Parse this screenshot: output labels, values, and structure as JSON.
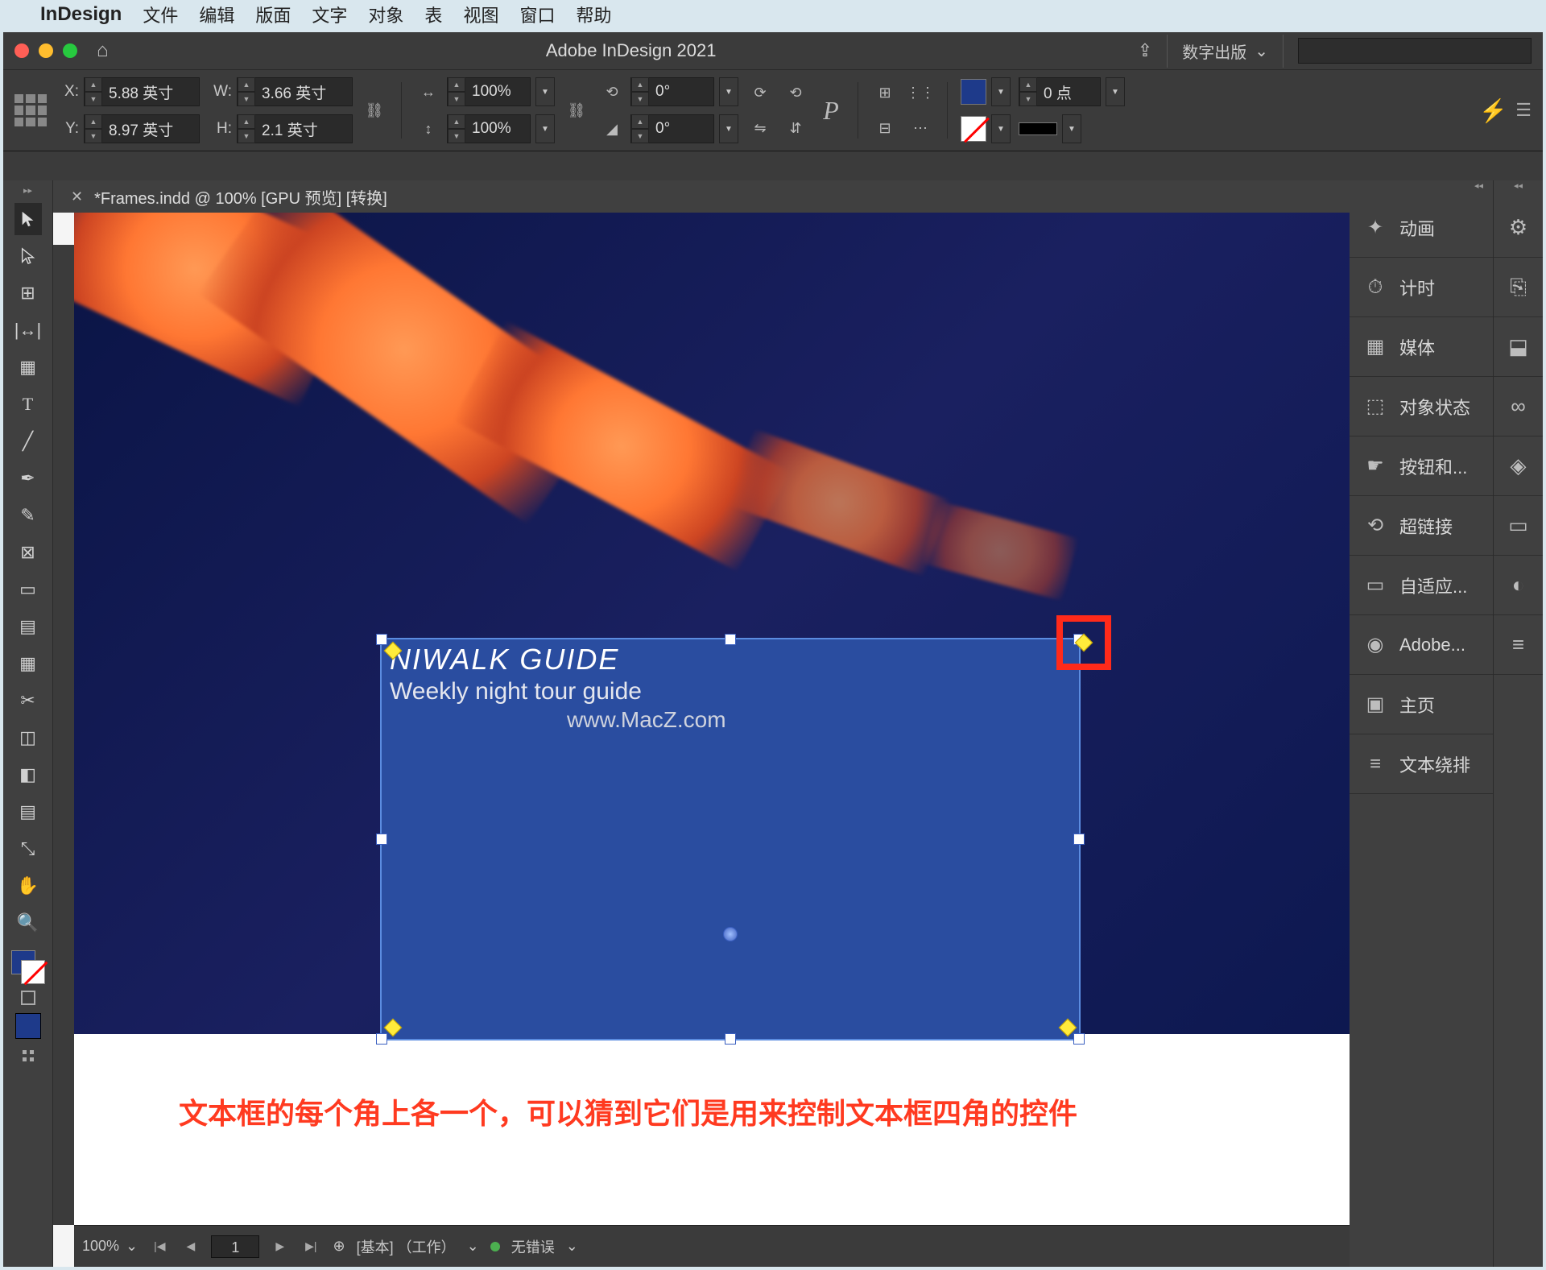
{
  "mac_menu": {
    "app_name": "InDesign",
    "items": [
      "文件",
      "编辑",
      "版面",
      "文字",
      "对象",
      "表",
      "视图",
      "窗口",
      "帮助"
    ]
  },
  "titlebar": {
    "title": "Adobe InDesign 2021",
    "workspace": "数字出版"
  },
  "control": {
    "x": "5.88 英寸",
    "y": "8.97 英寸",
    "w": "3.66 英寸",
    "h": "2.1 英寸",
    "scale_x": "100%",
    "scale_y": "100%",
    "rotate": "0°",
    "shear": "0°",
    "stroke_pt": "0 点",
    "fill_color": "#1e3a8a"
  },
  "doc_tab": "*Frames.indd @ 100% [GPU 预览] [转换]",
  "text_frame": {
    "line1": "NIWALK  GUIDE",
    "line2": "Weekly night tour guide",
    "line3": "www.MacZ.com"
  },
  "annotation": "文本框的每个角上各一个，可以猜到它们是用来控制文本框四角的控件",
  "status": {
    "zoom": "100%",
    "page": "1",
    "preset": "[基本] （工作）",
    "errors": "无错误"
  },
  "panels": [
    {
      "icon": "✦",
      "label": "动画"
    },
    {
      "icon": "⏱",
      "label": "计时"
    },
    {
      "icon": "▦",
      "label": "媒体"
    },
    {
      "icon": "⬚",
      "label": "对象状态"
    },
    {
      "icon": "☛",
      "label": "按钮和..."
    },
    {
      "icon": "⟲",
      "label": "超链接"
    },
    {
      "icon": "▭",
      "label": "自适应..."
    },
    {
      "icon": "◉",
      "label": "Adobe..."
    },
    {
      "icon": "▣",
      "label": "主页"
    },
    {
      "icon": "≡",
      "label": "文本绕排"
    }
  ],
  "panels2_icons": [
    "⚙",
    "⎘",
    "⬓",
    "∞",
    "◈",
    "▭",
    "◐",
    "≡"
  ]
}
